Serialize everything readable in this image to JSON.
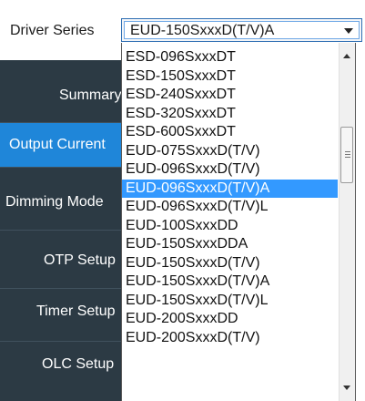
{
  "header": {
    "driver_series_label": "Driver Series",
    "selected_value": "EUD-150SxxxD(T/V)A"
  },
  "sidebar": {
    "items": [
      {
        "label": "Summary"
      },
      {
        "label": "Output Current"
      },
      {
        "label": "Dimming Mode"
      },
      {
        "label": "OTP Setup"
      },
      {
        "label": "Timer Setup"
      },
      {
        "label": "OLC Setup"
      }
    ],
    "active_index": 1
  },
  "dropdown": {
    "options": [
      "ESD-096SxxxDT",
      "ESD-150SxxxDT",
      "ESD-240SxxxDT",
      "ESD-320SxxxDT",
      "ESD-600SxxxDT",
      "EUD-075SxxxD(T/V)",
      "EUD-096SxxxD(T/V)",
      "EUD-096SxxxD(T/V)A",
      "EUD-096SxxxD(T/V)L",
      "EUD-100SxxxDD",
      "EUD-150SxxxDDA",
      "EUD-150SxxxD(T/V)",
      "EUD-150SxxxD(T/V)A",
      "EUD-150SxxxD(T/V)L",
      "EUD-200SxxxDD",
      "EUD-200SxxxD(T/V)"
    ],
    "highlighted": "EUD-096SxxxD(T/V)A"
  },
  "colors": {
    "sidebar_bg": "#2c3a44",
    "sidebar_active": "#1f86d9",
    "selection": "#3399ff",
    "combo_border": "#2f6fb3"
  },
  "icons": {
    "combo_arrow": "chevron-down-icon",
    "scroll_up": "scroll-up-arrow-icon",
    "scroll_down": "scroll-down-arrow-icon"
  }
}
